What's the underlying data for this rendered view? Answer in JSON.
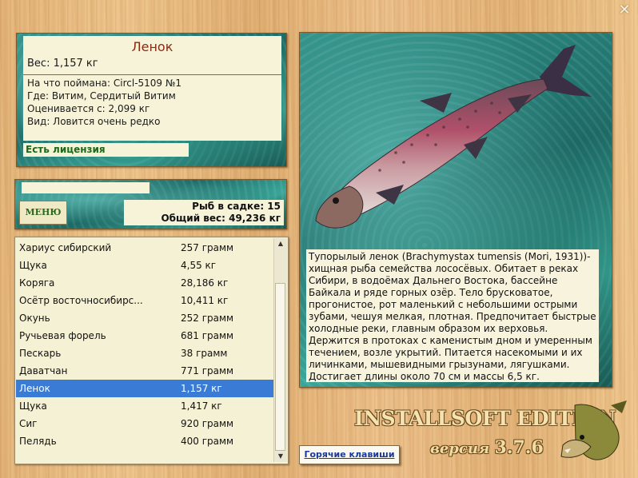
{
  "window": {
    "close_glyph": "✕"
  },
  "info": {
    "fish_name": "Ленок",
    "weight": "Вес: 1,157 кг",
    "caught_with": "На что поймана: Circl-5109 №1",
    "location": "Где: Витим, Сердитый Витим",
    "valued_from": "Оценивается с: 2,099 кг",
    "rarity": "Вид: Ловится очень редко",
    "license": "Есть лицензия"
  },
  "middle": {
    "menu_label": "МЕНЮ",
    "fish_in_keepnet": "Рыб в садке: 15",
    "total_weight": "Общий вес: 49,236 кг"
  },
  "catch_list": [
    {
      "name": "Хариус сибирский",
      "weight": "257 грамм"
    },
    {
      "name": "Щука",
      "weight": "4,55 кг"
    },
    {
      "name": "Коряга",
      "weight": "28,186 кг"
    },
    {
      "name": "Осётр восточносибирс...",
      "weight": "10,411 кг"
    },
    {
      "name": "Окунь",
      "weight": "252 грамм"
    },
    {
      "name": "Ручьевая форель",
      "weight": "681 грамм"
    },
    {
      "name": "Пескарь",
      "weight": "38 грамм"
    },
    {
      "name": "Даватчан",
      "weight": "771 грамм"
    },
    {
      "name": "Ленок",
      "weight": "1,157 кг",
      "selected": true
    },
    {
      "name": "Щука",
      "weight": "1,417 кг"
    },
    {
      "name": "Сиг",
      "weight": "920 грамм"
    },
    {
      "name": "Пелядь",
      "weight": "400 грамм"
    }
  ],
  "description": "Тупорылый ленок (Brachymystax tumensis (Mori, 1931))- хищная рыба семейства лососёвых. Обитает в реках Сибири, в водоёмах Дальнего Востока, бассейне Байкала и ряде горных озёр. Тело брусковатое, прогонистое, рот маленький с небольшими острыми зубами, чешуя мелкая, плотная. Предпочитает быстрые холодные реки, главным образом их верховья. Держится в протоках с каменистым дном и умеренным течением, возле укрытий. Питается насекомыми и их личинками, мышевидными грызунами, лягушками. Достигает длины около 70 см и массы 6,5 кг.",
  "hotkeys_label": "Горячие клавиши",
  "brand": {
    "edition": "INSTALLSOFT EDITION",
    "version_word": "версия",
    "version_number": "3.7.6"
  },
  "icons": {
    "close": "close-icon",
    "scroll_up": "arrow-up-icon",
    "scroll_down": "arrow-down-icon",
    "logo": "pike-fish-icon"
  }
}
